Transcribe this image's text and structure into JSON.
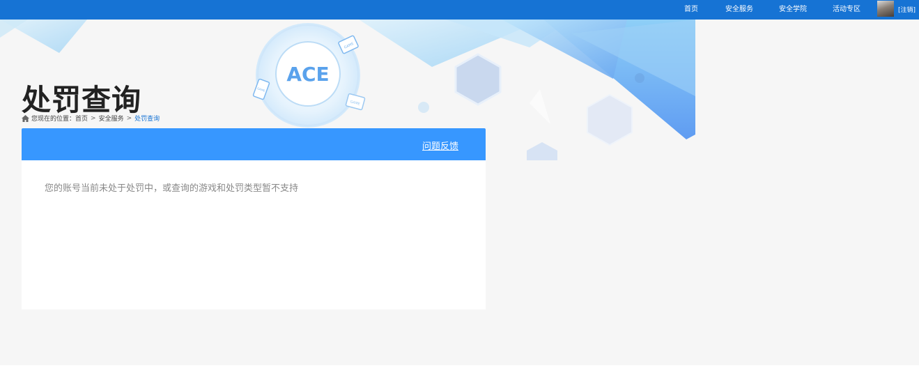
{
  "nav": {
    "items": [
      {
        "label": "首页"
      },
      {
        "label": "安全服务"
      },
      {
        "label": "安全学院"
      },
      {
        "label": "活动专区"
      }
    ],
    "logout": "[注销]"
  },
  "hero": {
    "logo_text": "ACE",
    "tile_labels": [
      "GAME",
      "GAME",
      "GAME"
    ]
  },
  "page": {
    "title": "处罚查询"
  },
  "breadcrumb": {
    "prefix": "您现在的位置：",
    "items": [
      "首页",
      "安全服务",
      "处罚查询"
    ],
    "separator": ">"
  },
  "panel": {
    "feedback_label": "问题反馈",
    "message": "您的账号当前未处于处罚中，或查询的游戏和处罚类型暂不支持"
  },
  "colors": {
    "nav_bg": "#1673d4",
    "panel_header": "#3797ff",
    "page_bg": "#f6f6f6"
  }
}
